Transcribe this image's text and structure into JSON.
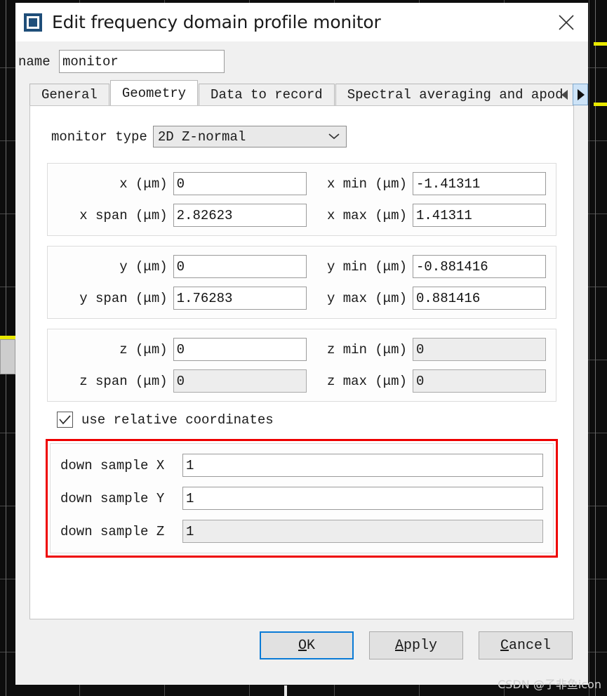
{
  "window": {
    "title": "Edit frequency domain profile monitor",
    "app_icon": "monitor-square-icon",
    "close_icon": "close-icon"
  },
  "name_row": {
    "label": "name",
    "value": "monitor",
    "placeholder": ""
  },
  "tabs": [
    {
      "label": "General",
      "active": false
    },
    {
      "label": "Geometry",
      "active": true
    },
    {
      "label": "Data to record",
      "active": false
    },
    {
      "label": "Spectral averaging and apod",
      "active": false
    }
  ],
  "tab_scroll": {
    "left_icon": "triangle-left-icon",
    "right_icon": "triangle-right-icon"
  },
  "monitor_type": {
    "label": "monitor type",
    "value": "2D Z-normal",
    "chevron_icon": "chevron-down-icon"
  },
  "groups": [
    {
      "id": "x-group",
      "rows": [
        {
          "label_left": "x (μm)",
          "value_left": "0",
          "left_disabled": false,
          "label_right": "x min (μm)",
          "value_right": "-1.41311",
          "right_disabled": false
        },
        {
          "label_left": "x span (μm)",
          "value_left": "2.82623",
          "left_disabled": false,
          "label_right": "x max (μm)",
          "value_right": "1.41311",
          "right_disabled": false
        }
      ]
    },
    {
      "id": "y-group",
      "rows": [
        {
          "label_left": "y (μm)",
          "value_left": "0",
          "left_disabled": false,
          "label_right": "y min (μm)",
          "value_right": "-0.881416",
          "right_disabled": false
        },
        {
          "label_left": "y span (μm)",
          "value_left": "1.76283",
          "left_disabled": false,
          "label_right": "y max (μm)",
          "value_right": "0.881416",
          "right_disabled": false
        }
      ]
    },
    {
      "id": "z-group",
      "rows": [
        {
          "label_left": "z (μm)",
          "value_left": "0",
          "left_disabled": false,
          "label_right": "z min (μm)",
          "value_right": "0",
          "right_disabled": true
        },
        {
          "label_left": "z span (μm)",
          "value_left": "0",
          "left_disabled": true,
          "label_right": "z max (μm)",
          "value_right": "0",
          "right_disabled": true
        }
      ]
    }
  ],
  "relative_coords": {
    "label": "use relative coordinates",
    "checked": true,
    "check_icon": "checkmark-icon"
  },
  "downsample": {
    "highlight_color": "#ee0000",
    "rows": [
      {
        "label": "down sample X",
        "value": "1",
        "disabled": false
      },
      {
        "label": "down sample Y",
        "value": "1",
        "disabled": false
      },
      {
        "label": "down sample Z",
        "value": "1",
        "disabled": true
      }
    ]
  },
  "footer": {
    "ok": {
      "accel": "O",
      "rest": "K",
      "default": true
    },
    "apply": {
      "accel": "A",
      "rest": "pply",
      "default": false
    },
    "cancel": {
      "accel": "C",
      "rest": "ancel",
      "default": false
    }
  },
  "watermark": "CSDN @子非鱼icon",
  "colors": {
    "accent": "#0a7bd6",
    "highlight": "#ee0000",
    "title_icon": "#1f4e79",
    "dialog_bg": "#f0f0f0",
    "panel_bg": "#ffffff"
  }
}
